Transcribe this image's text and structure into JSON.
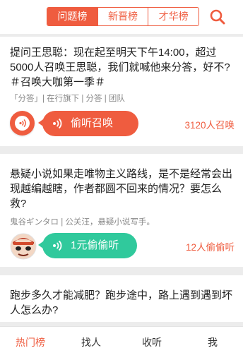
{
  "header": {
    "tabs": [
      {
        "label": "问题榜",
        "active": true
      },
      {
        "label": "新晋榜",
        "active": false
      },
      {
        "label": "才华榜",
        "active": false
      }
    ],
    "search_icon": "search-icon",
    "accent_color": "#ef5c3f"
  },
  "questions": [
    {
      "text": "提问王思聪：现在起至明天下午14:00，超过5000人召唤王思聪，我们就喊他来分答，好不?＃召唤大咖第一季＃",
      "meta": "「分答」| 在行旗下 | 分答 | 团队",
      "action_label": "偷听召唤",
      "count": "3120人召唤",
      "bubble_color": "#ef5c3f"
    },
    {
      "text": "悬疑小说如果走唯物主义路线，是不是经常会出现越编越瞎，作者都圆不回来的情况？要怎么救?",
      "meta": "鬼谷ギンタロ | 公关汪，悬疑小说写手。",
      "action_label": "1元偷偷听",
      "count": "12人偷偷听",
      "bubble_color": "#30c99c"
    },
    {
      "text": "跑步多久才能减肥？跑步途中，路上遇到遇到坏人怎么办?"
    }
  ],
  "bottom_nav": [
    {
      "label": "热门榜",
      "active": true
    },
    {
      "label": "找人",
      "active": false
    },
    {
      "label": "收听",
      "active": false
    },
    {
      "label": "我",
      "active": false
    }
  ]
}
